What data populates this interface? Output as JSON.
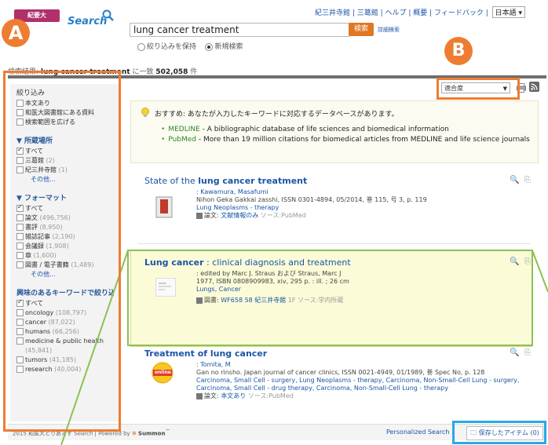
{
  "header": {
    "logo_badge": "紀要大",
    "logo_search": "Search",
    "search_value": "lung cancer treatment",
    "search_button": "検索",
    "advanced_link": "詳細検索",
    "scope_keep": "絞り込みを保持",
    "scope_new": "新規検索",
    "top_links": "紀三井寺館 | 三葛館 | ヘルプ | 概要 | フィードバック |",
    "language": "日本語"
  },
  "results_summary": {
    "prefix": "検索結果: ",
    "query": "lung cancer treatment",
    "middle": " に一致 ",
    "count": "502,058",
    "suffix": " 件"
  },
  "sidebar": {
    "narrow_title": "絞り込み",
    "narrow_items": [
      "本文あり",
      "和医大図書館にある資料",
      "検索範囲を広げる"
    ],
    "location_title": "▼ 所蔵場所",
    "location_items": [
      {
        "label": "すべて",
        "count": "",
        "checked": true
      },
      {
        "label": "三葛館",
        "count": "(2)",
        "checked": false
      },
      {
        "label": "紀三井寺館",
        "count": "(1)",
        "checked": false
      }
    ],
    "location_more": "その他...",
    "format_title": "▼ フォーマット",
    "format_items": [
      {
        "label": "すべて",
        "count": "",
        "checked": true
      },
      {
        "label": "論文",
        "count": "(496,756)",
        "checked": false
      },
      {
        "label": "書評",
        "count": "(8,950)",
        "checked": false
      },
      {
        "label": "雑誌記事",
        "count": "(2,190)",
        "checked": false
      },
      {
        "label": "会議録",
        "count": "(1,908)",
        "checked": false
      },
      {
        "label": "章",
        "count": "(1,600)",
        "checked": false
      },
      {
        "label": "図書 / 電子書籍",
        "count": "(1,489)",
        "checked": false
      }
    ],
    "format_more": "その他...",
    "keyword_title": "興味のあるキーワードで絞り込む",
    "keyword_items": [
      {
        "label": "すべて",
        "count": "",
        "checked": true
      },
      {
        "label": "oncology",
        "count": "(108,797)",
        "checked": false
      },
      {
        "label": "cancer",
        "count": "(87,022)",
        "checked": false
      },
      {
        "label": "humans",
        "count": "(66,256)",
        "checked": false
      },
      {
        "label": "medicine & public health",
        "count": "(45,841)",
        "checked": false
      },
      {
        "label": "tumors",
        "count": "(41,185)",
        "checked": false
      },
      {
        "label": "research",
        "count": "(40,004)",
        "checked": false
      }
    ]
  },
  "sort": {
    "selected": "適合度"
  },
  "recommend": {
    "text": "おすすめ: あなたが入力したキーワードに対応するデータベースがあります。",
    "items": [
      {
        "name": "MEDLINE",
        "desc": " - A bibliographic database of life sciences and biomedical information"
      },
      {
        "name": "PubMed",
        "desc": " - More than 19 million citations for biomedical articles from MEDLINE and life science journals"
      }
    ]
  },
  "results": [
    {
      "title_pre": "State of the ",
      "title_bold": "lung cancer treatment",
      "title_post": "",
      "author": ": Kawamura, Masafumi",
      "source": "Nihon Geka Gakkai zasshi, ISSN 0301-4894, 05/2014, 巻 115, 号 3, p. 119",
      "subjects": "Lung Neoplasms - therapy",
      "format": "論文:",
      "format_link": "文献情報のみ",
      "format_note": " ソース:PubMed"
    },
    {
      "title_pre": "",
      "title_bold": "Lung cancer",
      "title_post": " : clinical diagnosis and treatment",
      "title_bold2": "treatment",
      "author": ": edited by Marc J. Straus および Straus, Marc J",
      "source": "1977, ISBN 0808909983, xiv, 295 p. : ill. ; 26 cm",
      "subjects": "Lungs, Cancer",
      "format": "図書:",
      "format_link": "WF658 58 紀三井寺館",
      "format_note": " 1F ソース:学内所蔵"
    },
    {
      "title_pre": "Treatment",
      "title_bold": " of lung cancer",
      "title_post": "",
      "author": ": Tomita, M",
      "source": "Gan no rinsho. Japan journal of cancer clinics, ISSN 0021-4949, 01/1989, 巻 Spec No, p. 128",
      "subjects": "Carcinoma, Small Cell - surgery, Lung Neoplasms - therapy, Carcinoma, Non-Small-Cell Lung - surgery, Carcinoma, Small Cell - drug therapy, Carcinoma, Non-Small-Cell Lung - therapy",
      "format": "論文:",
      "format_link": "本文あり",
      "format_note": " ソース:PubMed",
      "badge": "online"
    }
  ],
  "footer": {
    "left": "2015 和医大とりあえず Search | Powered by",
    "powered": "Summon",
    "personalized": "Personalized Search",
    "saved": "保存したアイテム (0)"
  },
  "annotations": {
    "a": "A",
    "b": "B",
    "color": "#ee7d31",
    "blue": "#2aa8e6",
    "green": "#8cc152"
  },
  "colors": {
    "accent": "#e07722",
    "link": "#1a55a8",
    "brand": "#b0306a"
  }
}
